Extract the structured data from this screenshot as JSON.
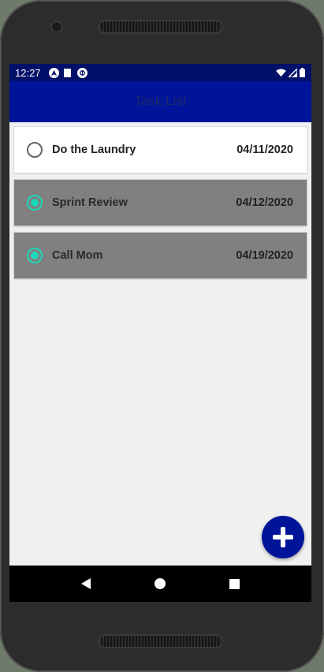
{
  "status_bar": {
    "time": "12:27",
    "icons": [
      "android-auto-icon",
      "sd-card-icon",
      "sync-icon"
    ],
    "right_icons": [
      "wifi-icon",
      "signal-icon",
      "battery-icon"
    ]
  },
  "app_bar": {
    "title": "Task List",
    "color": "#00149a"
  },
  "tasks": [
    {
      "name": "Do the Laundry",
      "date": "04/11/2020",
      "completed": false
    },
    {
      "name": "Sprint Review",
      "date": "04/12/2020",
      "completed": true
    },
    {
      "name": "Call Mom",
      "date": "04/19/2020",
      "completed": true
    }
  ],
  "fab": {
    "icon": "plus-icon",
    "color": "#00149a"
  },
  "navigation": {
    "buttons": [
      "back-icon",
      "home-icon",
      "recents-icon"
    ]
  },
  "colors": {
    "accent": "#1ed6b8",
    "completed_card": "#808080",
    "status_bar": "#000f68"
  }
}
